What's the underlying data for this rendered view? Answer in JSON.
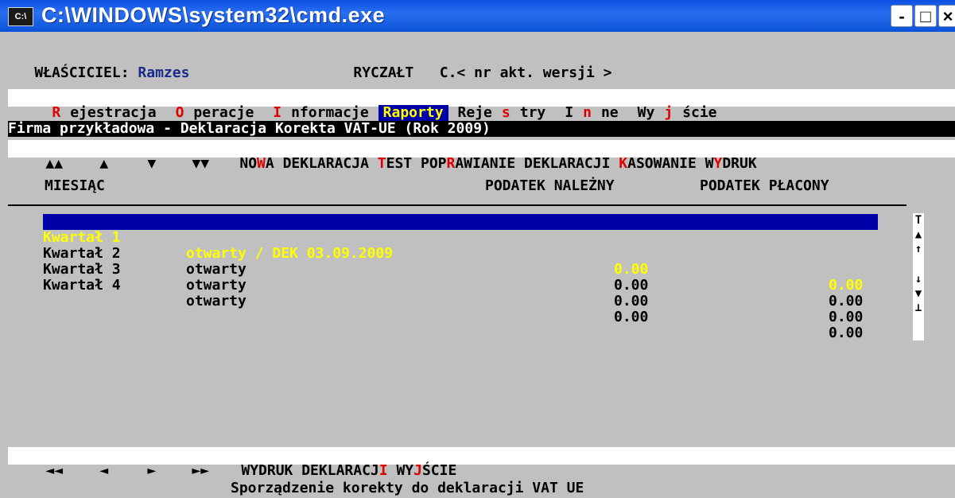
{
  "window": {
    "icon": "C:\\",
    "title": "C:\\WINDOWS\\system32\\cmd.exe",
    "btn_min": "-",
    "btn_max": "□",
    "btn_close": "×"
  },
  "status": {
    "owner_label": "WŁAŚCICIEL:",
    "owner_value": "Ramzes",
    "mode": "RYCZAŁT",
    "version": "C.< nr akt. wersji >"
  },
  "menu": [
    {
      "hot": "R",
      "rest": "ejestracja"
    },
    {
      "hot": "O",
      "rest": "peracje"
    },
    {
      "hot": "I",
      "rest": "nformacje"
    },
    {
      "label": "Raporty"
    },
    {
      "pre": "Reje",
      "hot": "s",
      "rest": "try"
    },
    {
      "pre": "I",
      "hot": "n",
      "rest": "ne"
    },
    {
      "pre": "Wy",
      "hot": "j",
      "rest": "ście"
    }
  ],
  "panel_title": "Firma przykładowa - Deklaracja Korekta VAT-UE (Rok 2009)",
  "toolbar": {
    "nav_first": "▲▲",
    "nav_prev": "▲",
    "nav_next": "▼",
    "nav_last": "▼▼",
    "new_pre": "NO",
    "new_hot": "W",
    "new_rest": "A DEKLARACJA",
    "test_hot": "T",
    "test_rest": "EST",
    "fix_pre": "POP",
    "fix_hot": "R",
    "fix_rest": "AWIANIE DEKLARACJI",
    "del_hot": "K",
    "del_rest": "ASOWANIE",
    "print_pre": "W",
    "print_hot": "Y",
    "print_rest": "DRUK"
  },
  "columns": {
    "month": "MIESIĄC",
    "tax_due": "PODATEK NALEŻNY",
    "tax_paid": "PODATEK PŁACONY"
  },
  "rows": [
    {
      "period": "Kwartał 1",
      "status": "otwarty / DEK 03.09.2009",
      "due": "0.00",
      "paid": "0.00"
    },
    {
      "period": "Kwartał 2",
      "status": "otwarty",
      "due": "0.00",
      "paid": "0.00"
    },
    {
      "period": "Kwartał 3",
      "status": "otwarty",
      "due": "0.00",
      "paid": "0.00"
    },
    {
      "period": "Kwartał 4",
      "status": "otwarty",
      "due": "0.00",
      "paid": "0.00"
    }
  ],
  "scrollbar": {
    "top": "T",
    "page_up": "▲",
    "up": "↑",
    "down": "↓",
    "page_down": "▼",
    "bottom": "⊥"
  },
  "bottom_bar": {
    "first": "◄◄",
    "prev": "◄",
    "next": "►",
    "last": "►►",
    "print_pre": "WYDRUK DEKLARACJ",
    "print_hot": "I",
    "exit_pre": "WY",
    "exit_hot": "J",
    "exit_rest": "ŚCIE"
  },
  "footer_text": "Sporządzenie korekty do deklaracji VAT UE"
}
